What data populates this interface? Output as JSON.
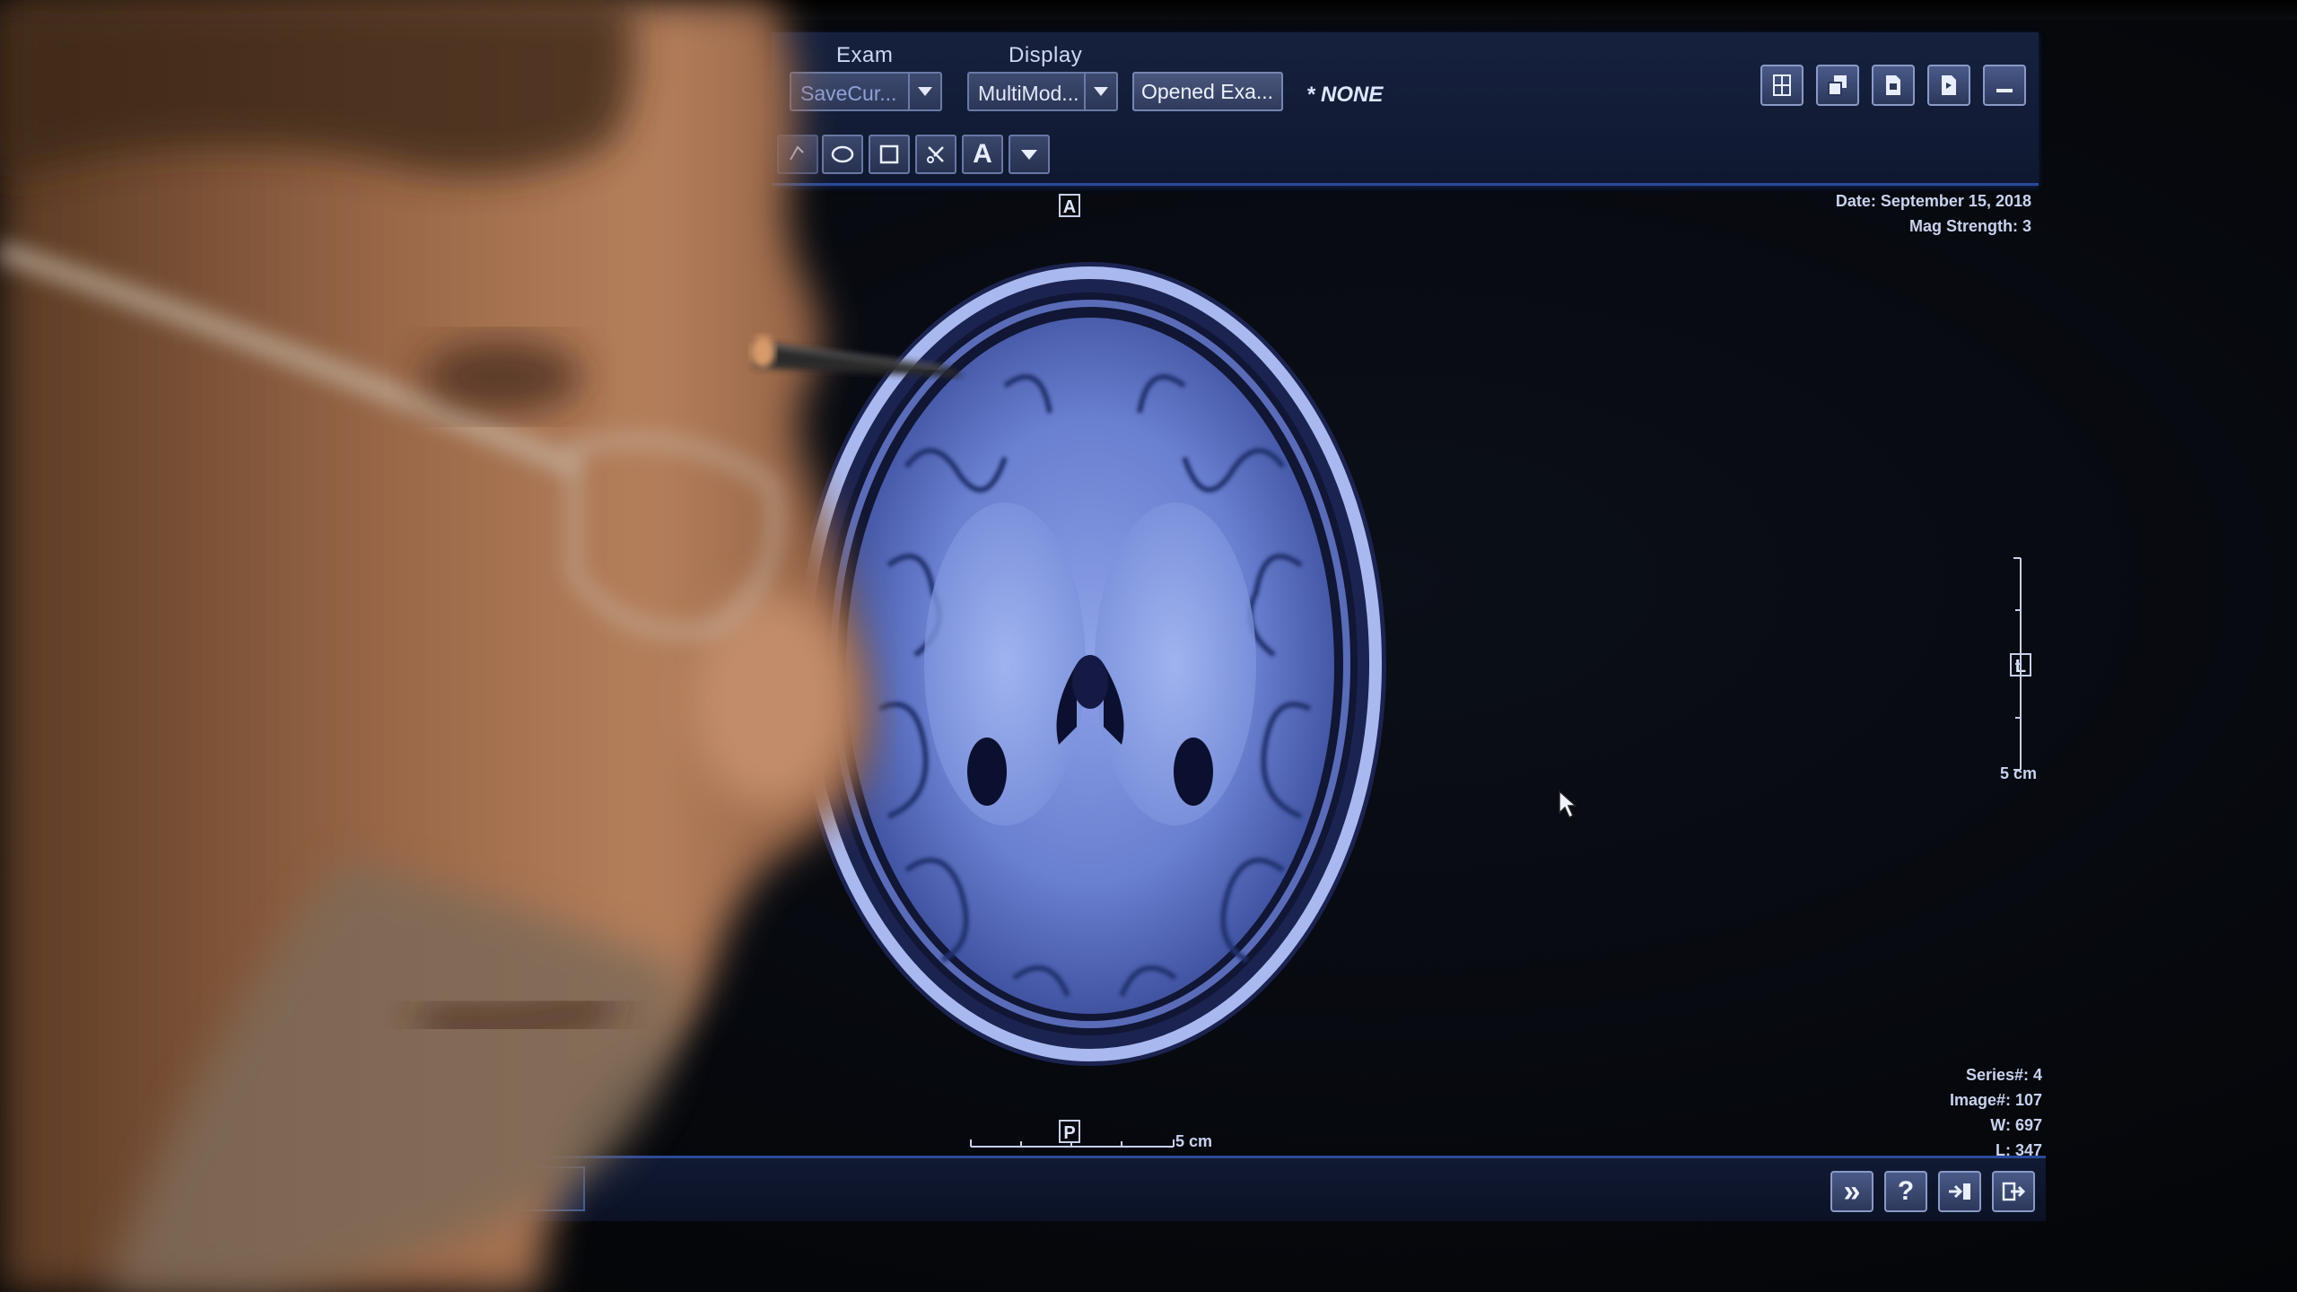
{
  "toolbar": {
    "exam_label": "Exam",
    "display_label": "Display",
    "exam_select_value": "SaveCur...",
    "display_select_value": "MultiMod...",
    "opened_exam_button": "Opened Exa...",
    "none_label": "* NONE",
    "tools": [
      "lasso-icon",
      "ellipse-icon",
      "rectangle-icon",
      "cut-icon",
      "text-icon",
      "more-tools-icon"
    ],
    "window_buttons": [
      "layout-icon",
      "copy-icon",
      "doc-icon",
      "page-icon",
      "minimize-icon"
    ]
  },
  "image_info": {
    "date": "Date: September 15, 2018",
    "mag_strength": "Mag Strength: 3",
    "series": "Series#: 4",
    "image": "Image#: 107",
    "window": "W: 697",
    "level": "L: 347"
  },
  "orientation": {
    "top": "A",
    "bottom": "P",
    "right": "L"
  },
  "scale": {
    "vertical_label": "5 cm",
    "horizontal_label": "5 cm"
  },
  "bottom_buttons": [
    "fast-forward-icon",
    "help-icon",
    "export-icon",
    "exit-icon"
  ],
  "bottom_glyphs": {
    "fast_forward": "»",
    "help": "?"
  },
  "colors": {
    "toolbar_bg": "#16213e",
    "accent_blue": "#2a4a9a",
    "mri_tissue": "#6f86d6"
  }
}
